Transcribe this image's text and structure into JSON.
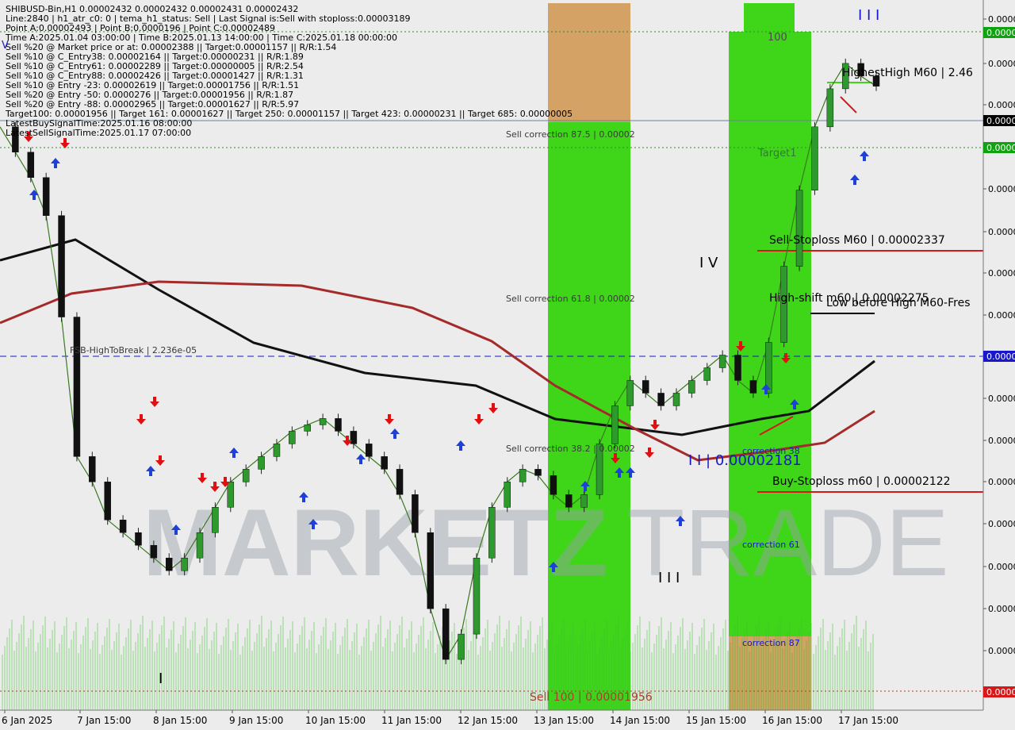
{
  "header": {
    "lines": [
      "SHIBUSD-Bin,H1  0.00002432 0.00002432 0.00002431 0.00002432",
      "Line:2840 | h1_atr_c0: 0 | tema_h1_status: Sell | Last Signal is:Sell with stoploss:0.00003189",
      "Point A:0.00002493 | Point B:0.0000196 | Point C:0.00002489",
      "Time A:2025.01.04 03:00:00 | Time B:2025.01.13 14:00:00 | Time C:2025.01.18 00:00:00",
      "Sell %20 @ Market price or at: 0.00002388 || Target:0.00001157 || R/R:1.54",
      "Sell %10 @ C_Entry38: 0.00002164 || Target:0.00000231 || R/R:1.89",
      "Sell %10 @ C_Entry61: 0.00002289 || Target:0.00000005 || R/R:2.54",
      "Sell %10 @ C_Entry88: 0.00002426 || Target:0.00001427 || R/R:1.31",
      "Sell %10 @ Entry -23: 0.00002619 || Target:0.00001756 || R/R:1.51",
      "Sell %20 @ Entry -50: 0.0000276 || Target:0.00001956 || R/R:1.87",
      "Sell %20 @ Entry -88: 0.00002965 || Target:0.00001627 || R/R:5.97",
      "Target100: 0.00001956 || Target 161: 0.00001627 || Target 250: 0.00001157 || Target 423: 0.00000231 || Target 685: 0.00000005",
      "LatestBuySignalTime:2025.01.16 08:00:00",
      "LatestSellSignalTime:2025.01.17 07:00:00"
    ]
  },
  "annotations": {
    "sell_corr_875": "Sell correction 87.5 | 0.00002",
    "sell_corr_618": "Sell correction 61.8 | 0.00002",
    "sell_corr_382": "Sell correction 38.2 | 0.00002",
    "sell_100": "Sell 100 | 0.00001956",
    "fsb": "FSB-HighToBreak | 2.236e-05",
    "level_100": "100",
    "target1": "Target1",
    "highest_high": "HighestHigh   M60 | 2.46",
    "sell_stoploss": "Sell-Stoploss M60 | 0.00002337",
    "high_shift": "High-shift m60 | 0.00002275",
    "low_before_high": "Low before High   M60-Fres",
    "ii_price": "I I | 0.00002181",
    "buy_stoploss": "Buy-Stoploss m60 | 0.00002122",
    "correction_38": "correction 38",
    "correction_61": "correction 61",
    "correction_87": "correction 87",
    "wave_iii_top": "I I I",
    "wave_iv": "I V",
    "wave_iii_bottom": "I I I",
    "wave_v": "V",
    "wave_i": "I"
  },
  "watermark": {
    "left": "MARKETZ",
    "right": "TRADE"
  },
  "price_axis": {
    "labels": [
      "0.0000",
      "0.0000",
      "0.0000",
      "0.0000",
      "0.0000",
      "0.0000",
      "0.0000",
      "0.0000",
      "0.0000",
      "0.0000",
      "0.0000",
      "0.0000",
      "0.0000",
      "0.0000",
      "0.0000",
      "0.0000",
      "0.0000"
    ],
    "tag_top": "0.0000",
    "tag_current": "0.0000",
    "tag_target1": "0.0000",
    "tag_fsb": "0.0000",
    "tag_bottom": "0.0000"
  },
  "colors": {
    "background": "#ececec",
    "green_zone": "#3fd61a",
    "orange_zone": "#d19a55",
    "ma_black": "#111111",
    "ma_red": "#a52a2a",
    "buy_arrow": "#1f3fd6",
    "sell_arrow": "#e01010",
    "tag_green": "#11a211",
    "tag_blue": "#1818c8",
    "tag_red": "#d81818"
  },
  "chart_data": {
    "type": "candlestick",
    "symbol": "SHIBUSD-Bin",
    "timeframe": "H1",
    "x_ticks": [
      "6 Jan 2025",
      "7 Jan 15:00",
      "8 Jan 15:00",
      "9 Jan 15:00",
      "10 Jan 15:00",
      "11 Jan 15:00",
      "12 Jan 15:00",
      "13 Jan 15:00",
      "14 Jan 15:00",
      "15 Jan 15:00",
      "16 Jan 15:00",
      "17 Jan 15:00"
    ],
    "close_path": [
      [
        0,
        2.4e-05
      ],
      [
        1,
        2.38e-05
      ],
      [
        2,
        2.36e-05
      ],
      [
        3,
        2.33e-05
      ],
      [
        4,
        2.25e-05
      ],
      [
        5,
        2.14e-05
      ],
      [
        6,
        2.12e-05
      ],
      [
        7,
        2.09e-05
      ],
      [
        8,
        2.08e-05
      ],
      [
        9,
        2.07e-05
      ],
      [
        10,
        2.06e-05
      ],
      [
        11,
        2.05e-05
      ],
      [
        12,
        2.06e-05
      ],
      [
        13,
        2.08e-05
      ],
      [
        14,
        2.1e-05
      ],
      [
        15,
        2.12e-05
      ],
      [
        16,
        2.13e-05
      ],
      [
        17,
        2.14e-05
      ],
      [
        18,
        2.15e-05
      ],
      [
        19,
        2.16e-05
      ],
      [
        20,
        2.165e-05
      ],
      [
        21,
        2.17e-05
      ],
      [
        22,
        2.16e-05
      ],
      [
        23,
        2.15e-05
      ],
      [
        24,
        2.14e-05
      ],
      [
        25,
        2.13e-05
      ],
      [
        26,
        2.11e-05
      ],
      [
        27,
        2.08e-05
      ],
      [
        28,
        2.02e-05
      ],
      [
        29,
        1.98e-05
      ],
      [
        30,
        2e-05
      ],
      [
        31,
        2.06e-05
      ],
      [
        32,
        2.1e-05
      ],
      [
        33,
        2.12e-05
      ],
      [
        34,
        2.13e-05
      ],
      [
        35,
        2.125e-05
      ],
      [
        36,
        2.11e-05
      ],
      [
        37,
        2.1e-05
      ],
      [
        38,
        2.11e-05
      ],
      [
        39,
        2.15e-05
      ],
      [
        40,
        2.18e-05
      ],
      [
        41,
        2.2e-05
      ],
      [
        42,
        2.19e-05
      ],
      [
        43,
        2.18e-05
      ],
      [
        44,
        2.19e-05
      ],
      [
        45,
        2.2e-05
      ],
      [
        46,
        2.21e-05
      ],
      [
        47,
        2.22e-05
      ],
      [
        48,
        2.2e-05
      ],
      [
        49,
        2.19e-05
      ],
      [
        50,
        2.23e-05
      ],
      [
        51,
        2.29e-05
      ],
      [
        52,
        2.35e-05
      ],
      [
        53,
        2.4e-05
      ],
      [
        54,
        2.43e-05
      ],
      [
        55,
        2.45e-05
      ],
      [
        56,
        2.44e-05
      ],
      [
        57,
        2.432e-05
      ]
    ],
    "levels": {
      "highest_high": 2.46e-05,
      "sell_stoploss": 2.337e-05,
      "high_shift": 2.275e-05,
      "fsb_high_to_break": 2.236e-05,
      "ii_level": 2.181e-05,
      "buy_stoploss": 2.122e-05,
      "sell_100": 1.956e-05
    },
    "x_range": [
      0,
      57
    ],
    "grid": false
  }
}
